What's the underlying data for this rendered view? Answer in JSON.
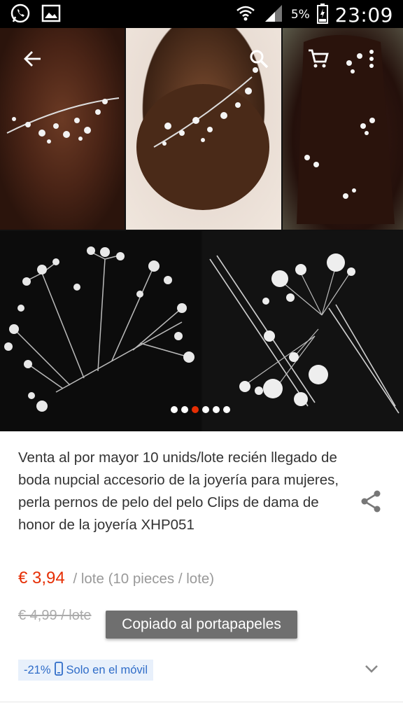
{
  "status_bar": {
    "battery_percent": "5%",
    "clock": "23:09"
  },
  "gallery": {
    "slide_count": 6,
    "active_slide": 3
  },
  "product": {
    "title": "Venta al por mayor 10 unids/lote recién llegado de boda nupcial accesorio de la joyería para mujeres, perla pernos de pelo del pelo Clips de dama de honor de la joyería XHP051",
    "price": "€ 3,94",
    "price_unit": "/ lote (10 pieces / lote)",
    "original_price": "€ 4,99 / lote",
    "discount": "-21%",
    "mobile_only": "Solo en el móvil"
  },
  "toast": {
    "message": "Copiado al portapapeles"
  },
  "colors": {
    "price": "#e62e04",
    "badge_text": "#2f6cc8",
    "badge_bg": "#e8f0fb",
    "toast_bg": "#6f6f6f"
  }
}
